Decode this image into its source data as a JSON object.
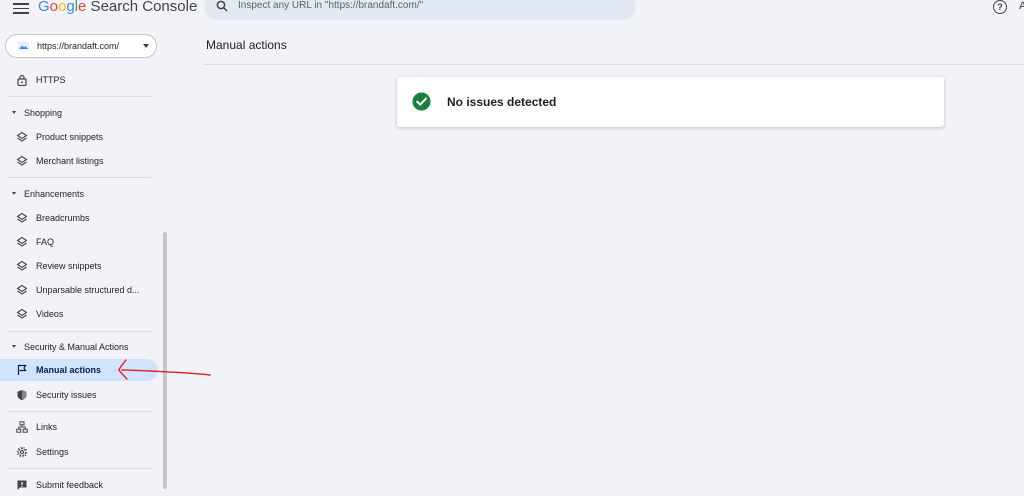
{
  "header": {
    "logo_google": "Google",
    "logo_rest": " Search Console",
    "search_placeholder": "Inspect any URL in \"https://brandaft.com/\"",
    "help_glyph": "?",
    "cutoff_char": "A"
  },
  "sidebar": {
    "property_url": "https://brandaft.com/",
    "top_item": {
      "label": "HTTPS",
      "icon": "lock-icon"
    },
    "sections": [
      {
        "label": "Shopping",
        "items": [
          {
            "label": "Product snippets",
            "icon": "layers-icon"
          },
          {
            "label": "Merchant listings",
            "icon": "layers-icon"
          }
        ]
      },
      {
        "label": "Enhancements",
        "items": [
          {
            "label": "Breadcrumbs",
            "icon": "layers-icon"
          },
          {
            "label": "FAQ",
            "icon": "layers-icon"
          },
          {
            "label": "Review snippets",
            "icon": "layers-icon"
          },
          {
            "label": "Unparsable structured d...",
            "icon": "layers-icon"
          },
          {
            "label": "Videos",
            "icon": "layers-icon"
          }
        ]
      },
      {
        "label": "Security & Manual Actions",
        "items": [
          {
            "label": "Manual actions",
            "icon": "flag-icon",
            "active": true
          },
          {
            "label": "Security issues",
            "icon": "shield-icon"
          }
        ]
      }
    ],
    "bottom_items": [
      {
        "label": "Links",
        "icon": "links-icon"
      },
      {
        "label": "Settings",
        "icon": "gear-icon"
      },
      {
        "label": "Submit feedback",
        "icon": "feedback-icon"
      }
    ]
  },
  "main": {
    "page_title": "Manual actions",
    "status_message": "No issues detected"
  },
  "colors": {
    "accent_active_bg": "#d3e3fd",
    "success_green": "#188038",
    "annotation_red": "#e02020",
    "background": "#f1f3f8"
  }
}
